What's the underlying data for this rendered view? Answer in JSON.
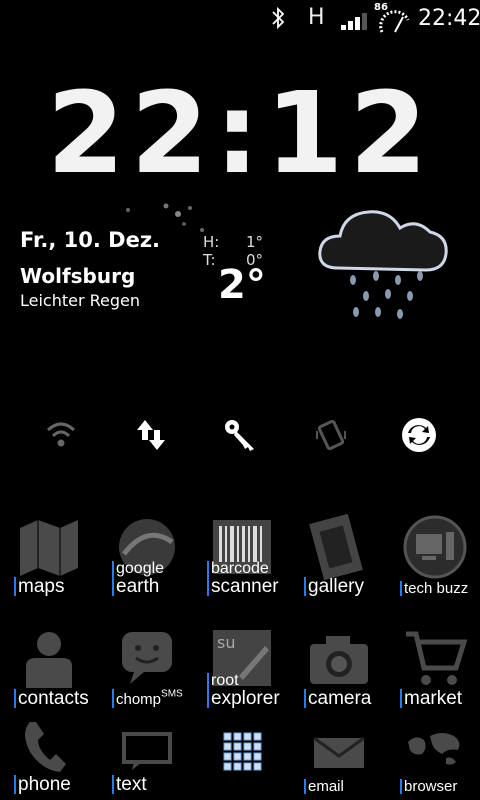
{
  "status_bar": {
    "network_type": "H",
    "battery_level": "86",
    "time": "22:42"
  },
  "clock": {
    "time": "22:12"
  },
  "weather": {
    "date": "Fr., 10. Dez.",
    "city": "Wolfsburg",
    "condition": "Leichter Regen",
    "high_label": "H:",
    "high_value": "1°",
    "low_label": "T:",
    "low_value": "0°",
    "current_temp": "2°"
  },
  "toggles": [
    {
      "name": "wifi-toggle",
      "icon": "wifi-icon"
    },
    {
      "name": "data-toggle",
      "icon": "data-arrows-icon"
    },
    {
      "name": "gps-toggle",
      "icon": "key-icon"
    },
    {
      "name": "rotation-toggle",
      "icon": "auto-rotate-icon"
    },
    {
      "name": "sync-toggle",
      "icon": "sync-icon"
    }
  ],
  "apps": {
    "maps": "maps",
    "google_earth_top": "google",
    "google_earth_bottom": "earth",
    "barcode_top": "barcode",
    "barcode_bottom": "scanner",
    "gallery": "gallery",
    "tech_buzz": "tech buzz",
    "contacts": "contacts",
    "chomp": "chomp",
    "chomp_sup": "SMS",
    "root_top": "root",
    "root_bottom": "explorer",
    "root_icon_text": "su",
    "camera": "camera",
    "market": "market",
    "phone": "phone",
    "text": "text",
    "email": "email",
    "browser": "browser"
  }
}
